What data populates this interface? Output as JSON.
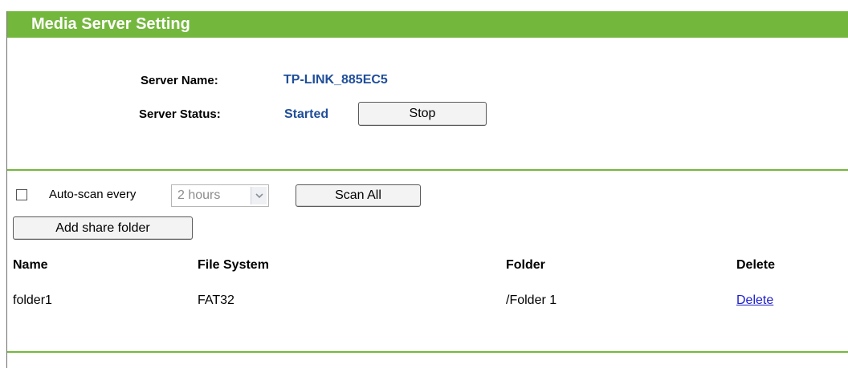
{
  "header": {
    "title": "Media Server Setting"
  },
  "server": {
    "name_label": "Server Name:",
    "name_value": "TP-LINK_885EC5",
    "status_label": "Server Status:",
    "status_value": "Started",
    "stop_label": "Stop"
  },
  "scan": {
    "auto_scan_checked": false,
    "auto_scan_label": "Auto-scan every",
    "interval_selected": "2 hours",
    "scan_all_label": "Scan All"
  },
  "folders": {
    "add_label": "Add share folder",
    "columns": [
      "Name",
      "File System",
      "Folder",
      "Delete"
    ],
    "rows": [
      {
        "name": "folder1",
        "file_system": "FAT32",
        "folder": "/Folder 1",
        "delete": "Delete"
      }
    ]
  },
  "colors": {
    "accent": "#74b73d",
    "value_text": "#1f4e99",
    "link": "#1c1ccf"
  },
  "icons": {
    "dropdown": "chevron-down-icon"
  }
}
